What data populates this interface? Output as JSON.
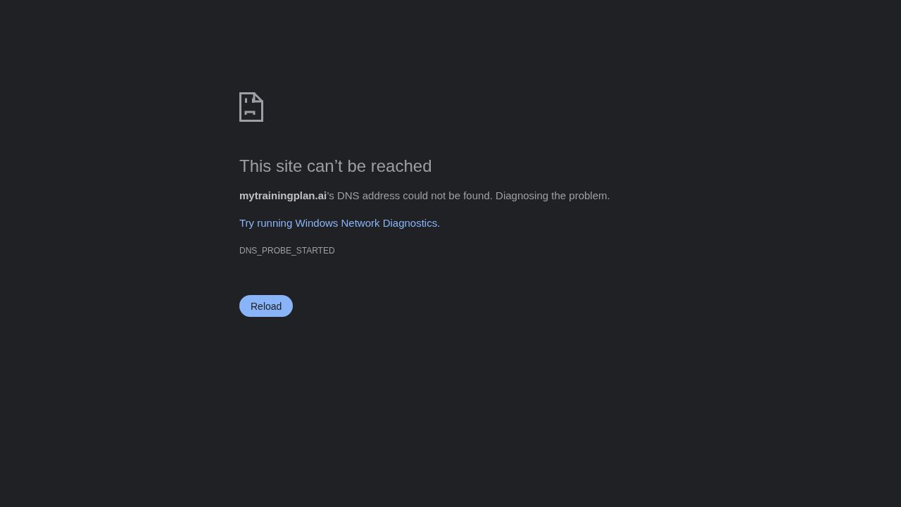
{
  "title": "This site can’t be reached",
  "message": "**mytrainingplan.ai**’s DNS address could not be found. Diagnosing the problem.",
  "suggestion_link": "Try running Windows Network Diagnostics.",
  "error_code": "DNS_PROBE_STARTED",
  "buttons": [
    {
      "label": "Reload"
    }
  ]
}
